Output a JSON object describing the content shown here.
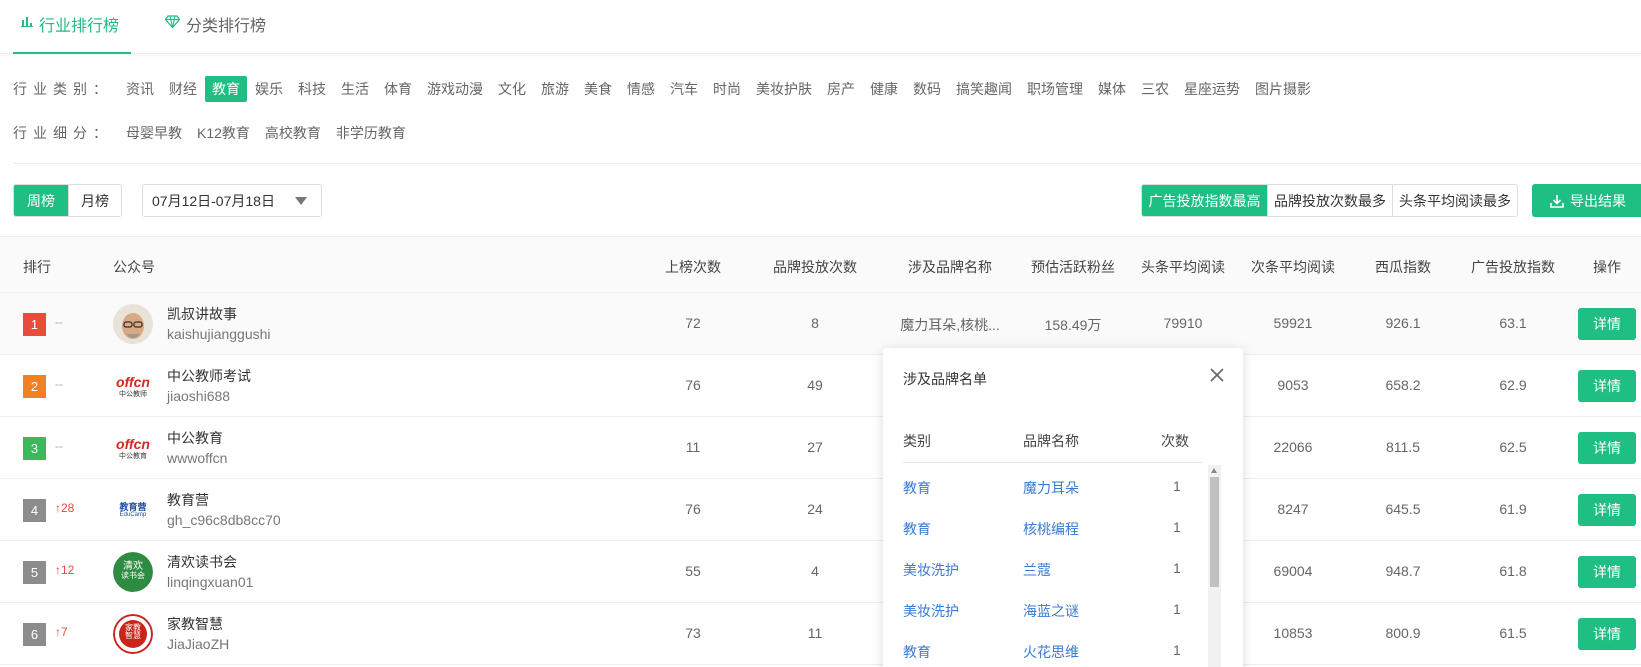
{
  "tabs": {
    "industry": "行业排行榜",
    "category": "分类排行榜"
  },
  "filters": {
    "type_label": "行业类别：",
    "types": [
      "资讯",
      "财经",
      "教育",
      "娱乐",
      "科技",
      "生活",
      "体育",
      "游戏动漫",
      "文化",
      "旅游",
      "美食",
      "情感",
      "汽车",
      "时尚",
      "美妆护肤",
      "房产",
      "健康",
      "数码",
      "搞笑趣闻",
      "职场管理",
      "媒体",
      "三农",
      "星座运势",
      "图片摄影"
    ],
    "active_type": "教育",
    "sub_label": "行业细分：",
    "subs": [
      "母婴早教",
      "K12教育",
      "高校教育",
      "非学历教育"
    ]
  },
  "toolbar": {
    "weekly": "周榜",
    "monthly": "月榜",
    "date_range": "07月12日-07月18日",
    "sort_options": [
      "广告投放指数最高",
      "品牌投放次数最多",
      "头条平均阅读最多"
    ],
    "export": "导出结果"
  },
  "table": {
    "headers": {
      "rank": "排行",
      "account": "公众号",
      "times_listed": "上榜次数",
      "brand_ads": "品牌投放次数",
      "brands": "涉及品牌名称",
      "fans": "预估活跃粉丝",
      "head_read": "头条平均阅读",
      "second_read": "次条平均阅读",
      "xigua": "西瓜指数",
      "ad_index": "广告投放指数",
      "action": "操作"
    },
    "rows": [
      {
        "rank": "1",
        "change": "--",
        "name": "凯叔讲故事",
        "id": "kaishujianggushi",
        "times": "72",
        "brand_ads": "8",
        "brands": "魔力耳朵,核桃...",
        "fans": "158.49万",
        "head": "79910",
        "second": "59921",
        "xigua": "926.1",
        "ad": "63.1"
      },
      {
        "rank": "2",
        "change": "--",
        "name": "中公教师考试",
        "id": "jiaoshi688",
        "times": "76",
        "brand_ads": "49",
        "brands": "",
        "fans": "",
        "head": "",
        "second": "9053",
        "xigua": "658.2",
        "ad": "62.9"
      },
      {
        "rank": "3",
        "change": "--",
        "name": "中公教育",
        "id": "wwwoffcn",
        "times": "11",
        "brand_ads": "27",
        "brands": "",
        "fans": "",
        "head": "",
        "second": "22066",
        "xigua": "811.5",
        "ad": "62.5"
      },
      {
        "rank": "4",
        "change": "↑28",
        "name": "教育营",
        "id": "gh_c96c8db8cc70",
        "times": "76",
        "brand_ads": "24",
        "brands": "",
        "fans": "",
        "head": "",
        "second": "8247",
        "xigua": "645.5",
        "ad": "61.9"
      },
      {
        "rank": "5",
        "change": "↑12",
        "name": "清欢读书会",
        "id": "linqingxuan01",
        "times": "55",
        "brand_ads": "4",
        "brands": "",
        "fans": "",
        "head": "",
        "second": "69004",
        "xigua": "948.7",
        "ad": "61.8"
      },
      {
        "rank": "6",
        "change": "↑7",
        "name": "家教智慧",
        "id": "JiaJiaoZH",
        "times": "73",
        "brand_ads": "11",
        "brands": "",
        "fans": "",
        "head": "",
        "second": "10853",
        "xigua": "800.9",
        "ad": "61.5"
      }
    ],
    "detail_label": "详情"
  },
  "popover": {
    "title": "涉及品牌名单",
    "headers": {
      "category": "类别",
      "brand": "品牌名称",
      "count": "次数"
    },
    "rows": [
      {
        "category": "教育",
        "brand": "魔力耳朵",
        "count": "1"
      },
      {
        "category": "教育",
        "brand": "核桃编程",
        "count": "1"
      },
      {
        "category": "美妆洗护",
        "brand": "兰蔻",
        "count": "1"
      },
      {
        "category": "美妆洗护",
        "brand": "海蓝之谜",
        "count": "1"
      },
      {
        "category": "教育",
        "brand": "火花思维",
        "count": "1"
      }
    ]
  },
  "avatar_text": {
    "offcn": "offcn",
    "offcn_sub1": "中公教师",
    "offcn_sub2": "中公教育",
    "jiaoyuying": "教育营",
    "jiaoyuying_sub": "EduCamp",
    "qinghuan1": "清欢",
    "qinghuan2": "读书会",
    "jiajiao1": "家教",
    "jiajiao2": "智慧"
  },
  "colors": {
    "accent": "#1fbe83",
    "rank1": "#e84c3d",
    "rank2": "#f48120",
    "rank3": "#3cb85c",
    "rank_other": "#8c8c8c",
    "rise": "#e84c3d",
    "link": "#3a7bd5"
  }
}
